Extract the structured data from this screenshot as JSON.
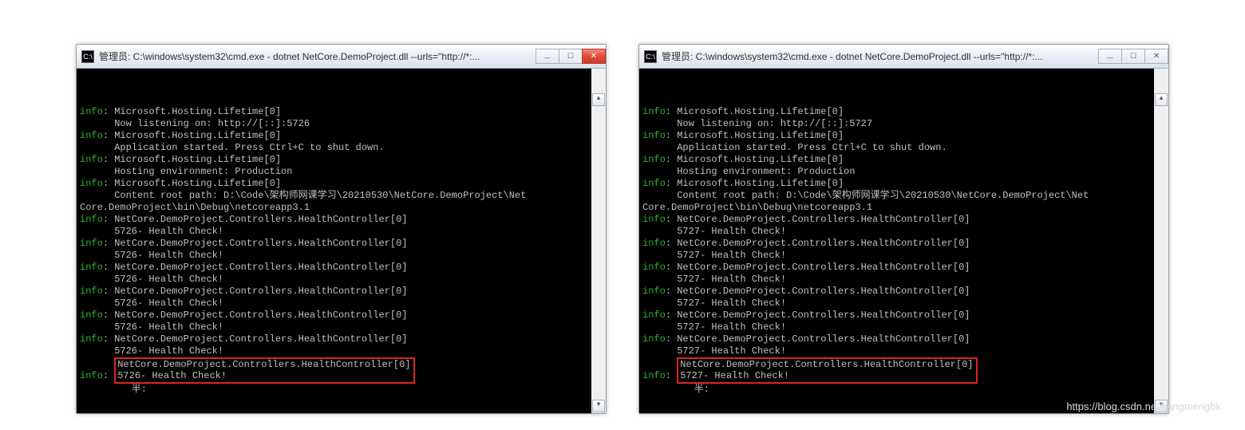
{
  "watermark": "https://blog.csdn.net/liangmengbk",
  "windows": [
    {
      "title": "管理员: C:\\windows\\system32\\cmd.exe - dotnet  NetCore.DemoProject.dll --urls=\"http://*:...",
      "icon_text": "C:\\",
      "close_style": "red",
      "lines": [
        {
          "prefix": "info",
          "text": ": Microsoft.Hosting.Lifetime[0]"
        },
        {
          "text": "      Now listening on: http://[::]:5726"
        },
        {
          "prefix": "info",
          "text": ": Microsoft.Hosting.Lifetime[0]"
        },
        {
          "text": "      Application started. Press Ctrl+C to shut down."
        },
        {
          "prefix": "info",
          "text": ": Microsoft.Hosting.Lifetime[0]"
        },
        {
          "text": "      Hosting environment: Production"
        },
        {
          "prefix": "info",
          "text": ": Microsoft.Hosting.Lifetime[0]"
        },
        {
          "text": "      Content root path: D:\\Code\\架构师网课学习\\20210530\\NetCore.DemoProject\\Net"
        },
        {
          "text": "Core.DemoProject\\bin\\Debug\\netcoreapp3.1"
        },
        {
          "prefix": "info",
          "text": ": NetCore.DemoProject.Controllers.HealthController[0]"
        },
        {
          "text": "      5726- Health Check!"
        },
        {
          "prefix": "info",
          "text": ": NetCore.DemoProject.Controllers.HealthController[0]"
        },
        {
          "text": "      5726- Health Check!"
        },
        {
          "prefix": "info",
          "text": ": NetCore.DemoProject.Controllers.HealthController[0]"
        },
        {
          "text": "      5726- Health Check!"
        },
        {
          "prefix": "info",
          "text": ": NetCore.DemoProject.Controllers.HealthController[0]"
        },
        {
          "text": "      5726- Health Check!"
        },
        {
          "prefix": "info",
          "text": ": NetCore.DemoProject.Controllers.HealthController[0]"
        },
        {
          "text": "      5726- Health Check!"
        },
        {
          "prefix": "info",
          "text": ": NetCore.DemoProject.Controllers.HealthController[0]"
        },
        {
          "text": "      5726- Health Check!"
        }
      ],
      "highlight_line1": "NetCore.DemoProject.Controllers.HealthController[0]",
      "highlight_line2": "5726- Health Check!",
      "input_prompt": "半:"
    },
    {
      "title": "管理员: C:\\windows\\system32\\cmd.exe - dotnet  NetCore.DemoProject.dll --urls=\"http://*:...",
      "icon_text": "C:\\",
      "close_style": "gray",
      "lines": [
        {
          "prefix": "info",
          "text": ": Microsoft.Hosting.Lifetime[0]"
        },
        {
          "text": "      Now listening on: http://[::]:5727"
        },
        {
          "prefix": "info",
          "text": ": Microsoft.Hosting.Lifetime[0]"
        },
        {
          "text": "      Application started. Press Ctrl+C to shut down."
        },
        {
          "prefix": "info",
          "text": ": Microsoft.Hosting.Lifetime[0]"
        },
        {
          "text": "      Hosting environment: Production"
        },
        {
          "prefix": "info",
          "text": ": Microsoft.Hosting.Lifetime[0]"
        },
        {
          "text": "      Content root path: D:\\Code\\架构师网课学习\\20210530\\NetCore.DemoProject\\Net"
        },
        {
          "text": "Core.DemoProject\\bin\\Debug\\netcoreapp3.1"
        },
        {
          "prefix": "info",
          "text": ": NetCore.DemoProject.Controllers.HealthController[0]"
        },
        {
          "text": "      5727- Health Check!"
        },
        {
          "prefix": "info",
          "text": ": NetCore.DemoProject.Controllers.HealthController[0]"
        },
        {
          "text": "      5727- Health Check!"
        },
        {
          "prefix": "info",
          "text": ": NetCore.DemoProject.Controllers.HealthController[0]"
        },
        {
          "text": "      5727- Health Check!"
        },
        {
          "prefix": "info",
          "text": ": NetCore.DemoProject.Controllers.HealthController[0]"
        },
        {
          "text": "      5727- Health Check!"
        },
        {
          "prefix": "info",
          "text": ": NetCore.DemoProject.Controllers.HealthController[0]"
        },
        {
          "text": "      5727- Health Check!"
        },
        {
          "prefix": "info",
          "text": ": NetCore.DemoProject.Controllers.HealthController[0]"
        },
        {
          "text": "      5727- Health Check!"
        }
      ],
      "highlight_line1": "NetCore.DemoProject.Controllers.HealthController[0]",
      "highlight_line2": "5727- Health Check!",
      "input_prompt": "半:"
    }
  ]
}
